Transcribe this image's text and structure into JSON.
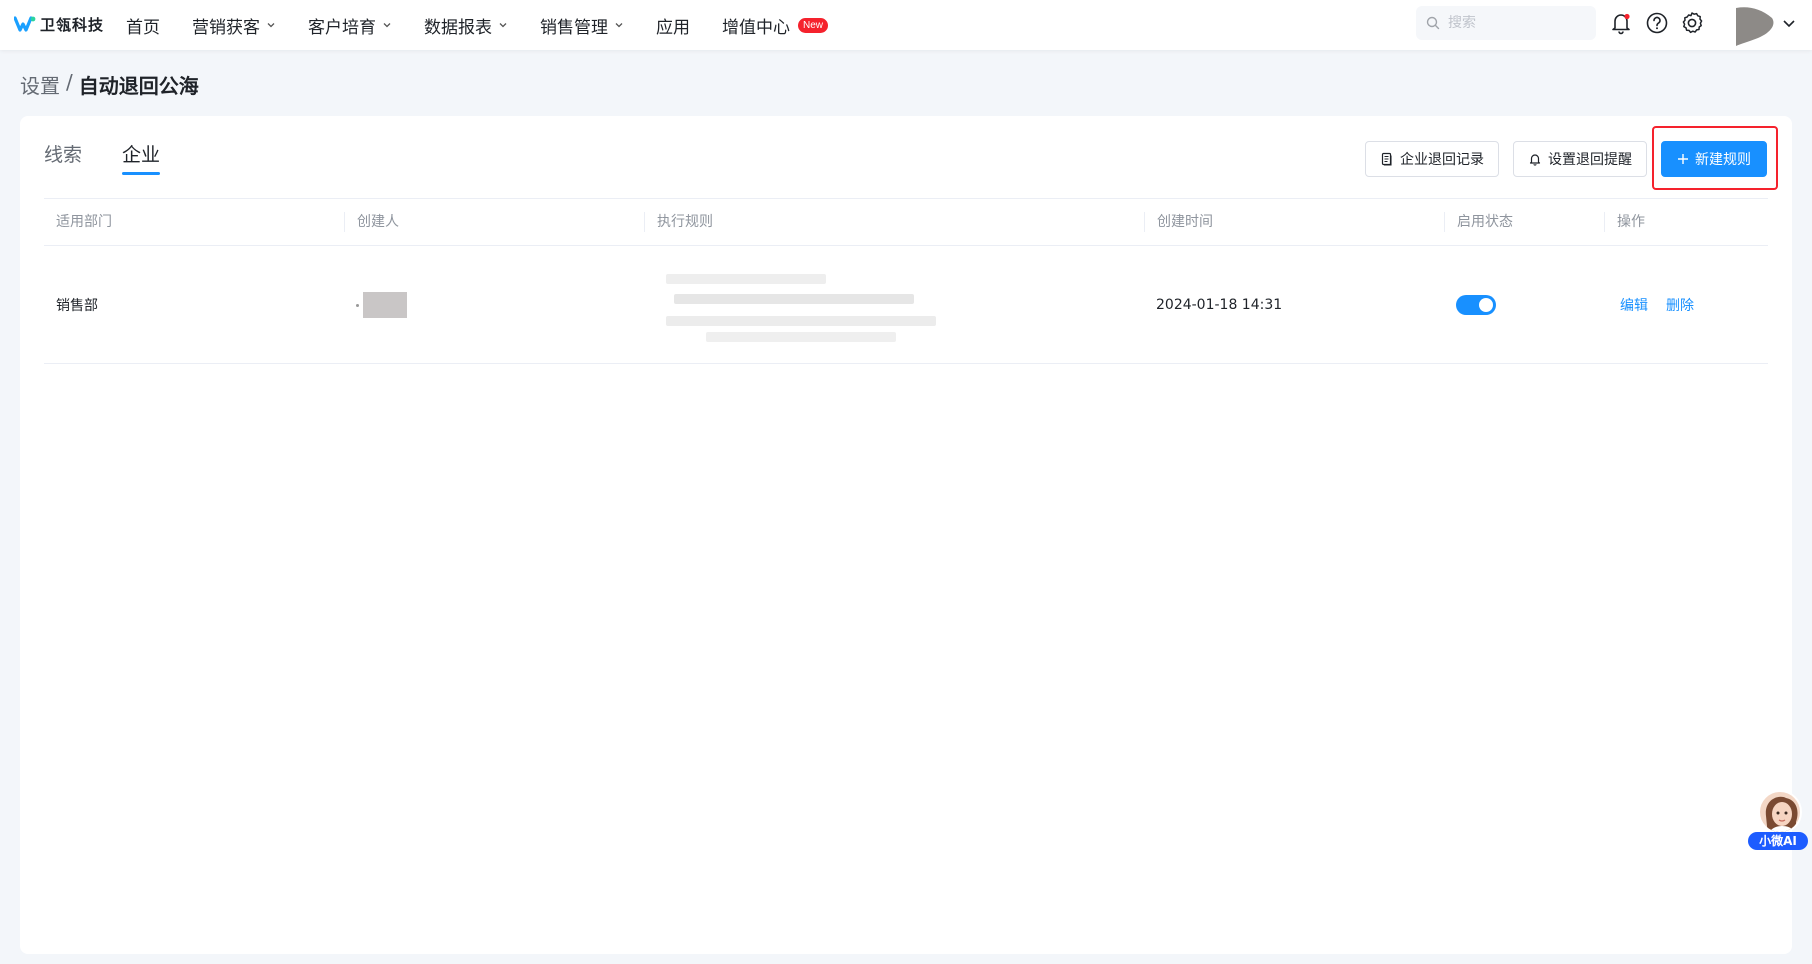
{
  "brand": {
    "name": "卫瓴科技"
  },
  "nav": {
    "items": [
      {
        "label": "首页",
        "dropdown": false
      },
      {
        "label": "营销获客",
        "dropdown": true
      },
      {
        "label": "客户培育",
        "dropdown": true
      },
      {
        "label": "数据报表",
        "dropdown": true
      },
      {
        "label": "销售管理",
        "dropdown": true
      },
      {
        "label": "应用",
        "dropdown": false
      },
      {
        "label": "增值中心",
        "dropdown": false,
        "badge": "New"
      }
    ],
    "search_placeholder": "搜索",
    "icons": [
      "bell-icon",
      "help-icon",
      "gear-icon"
    ]
  },
  "breadcrumb": {
    "parent": "设置",
    "separator": "/",
    "current": "自动退回公海"
  },
  "tabs": [
    {
      "label": "线索",
      "active": false
    },
    {
      "label": "企业",
      "active": true
    }
  ],
  "actions": {
    "records": "企业退回记录",
    "reminder": "设置退回提醒",
    "new_rule": "新建规则"
  },
  "table": {
    "headers": [
      "适用部门",
      "创建人",
      "执行规则",
      "创建时间",
      "启用状态",
      "操作"
    ],
    "rows": [
      {
        "department": "销售部",
        "creator": "",
        "rule": "",
        "created_at": "2024-01-18 14:31",
        "enabled": true,
        "ops": {
          "edit": "编辑",
          "delete": "删除"
        }
      }
    ]
  },
  "assistant": {
    "label": "小微AI"
  },
  "colors": {
    "primary": "#1890ff",
    "highlight": "#f5222d",
    "badge": "#f5222d"
  }
}
